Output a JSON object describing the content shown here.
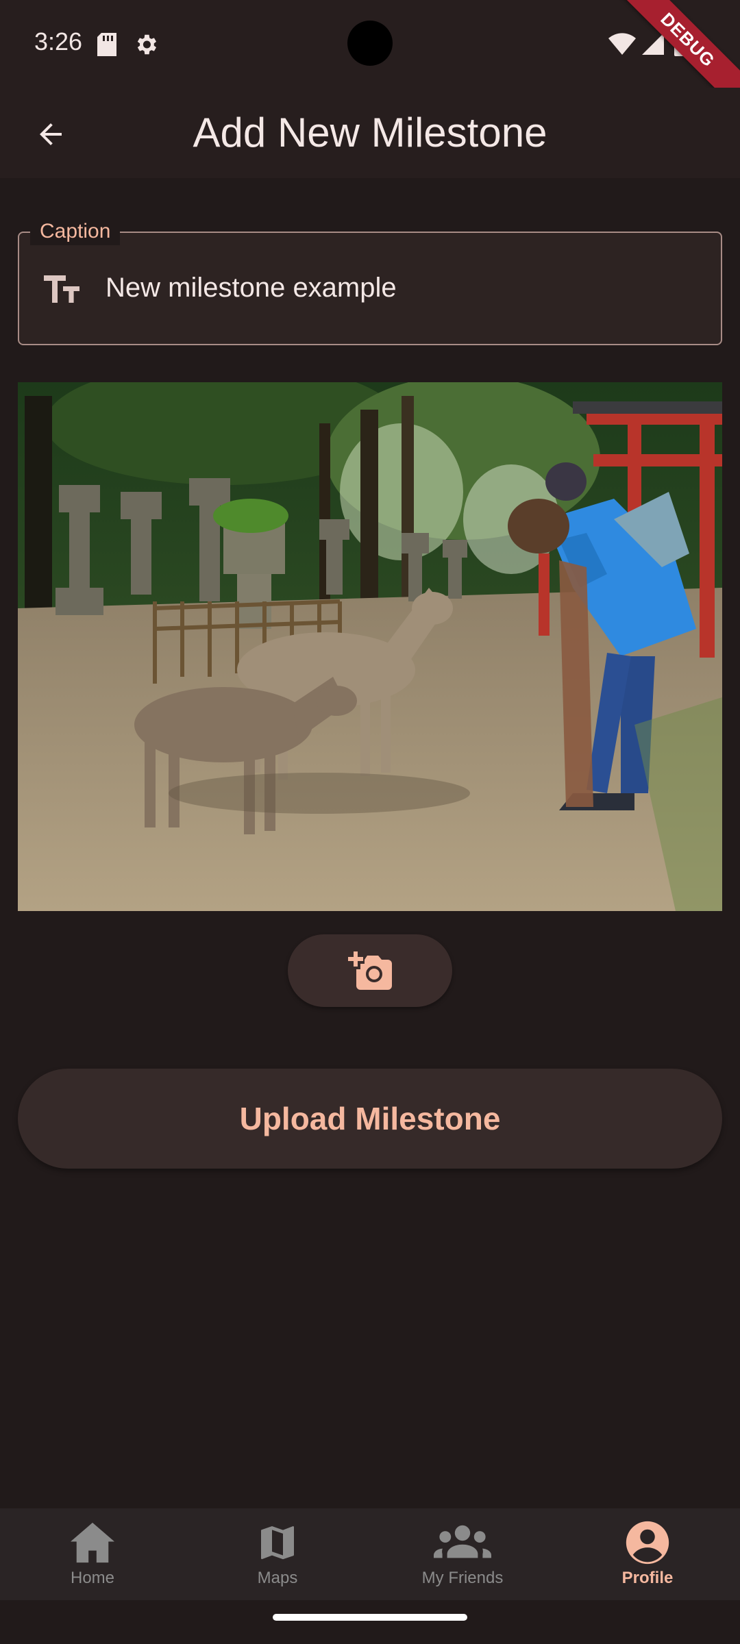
{
  "status_bar": {
    "time": "3:26",
    "icons": [
      "sd-card-icon",
      "settings-icon",
      "wifi-icon",
      "signal-icon",
      "battery-icon"
    ],
    "debug_banner": "DEBUG"
  },
  "app_bar": {
    "back_icon": "arrow-back-icon",
    "title": "Add New Milestone"
  },
  "caption": {
    "label": "Caption",
    "icon": "text-fields-icon",
    "value": "New milestone example"
  },
  "photo": {
    "icon": "photo"
  },
  "add_photo_button": {
    "icon": "add-a-photo-icon"
  },
  "upload_button": {
    "label": "Upload Milestone"
  },
  "bottom_nav": {
    "items": [
      {
        "label": "Home",
        "icon": "home-icon",
        "active": false
      },
      {
        "label": "Maps",
        "icon": "map-icon",
        "active": false
      },
      {
        "label": "My Friends",
        "icon": "group-icon",
        "active": false
      },
      {
        "label": "Profile",
        "icon": "account-circle-icon",
        "active": true
      }
    ]
  },
  "colors": {
    "background": "#211a1a",
    "accent": "#f5b89f",
    "inactive_nav": "#8b8b8b",
    "debug_ribbon": "#a7202f"
  }
}
